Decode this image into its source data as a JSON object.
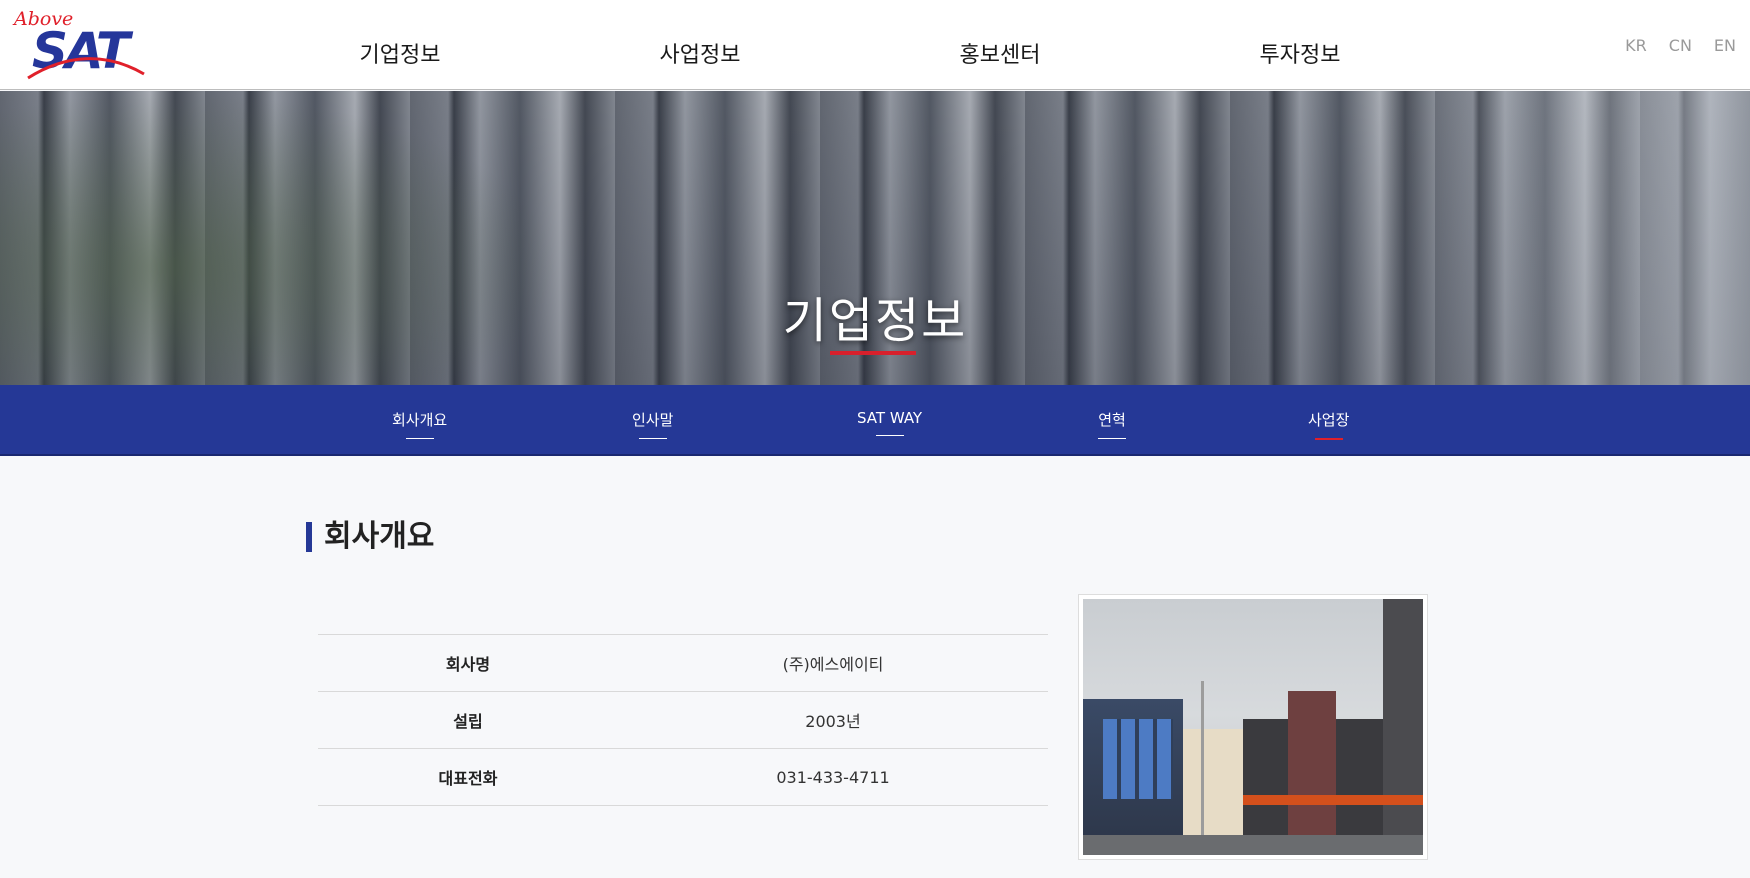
{
  "logo": {
    "above": "Above",
    "sat": "SAT"
  },
  "main_nav": [
    "기업정보",
    "사업정보",
    "홍보센터",
    "투자정보"
  ],
  "lang": [
    "KR",
    "CN",
    "EN"
  ],
  "hero": {
    "title": "기업정보"
  },
  "sub_nav": [
    {
      "label": "회사개요",
      "active": false
    },
    {
      "label": "인사말",
      "active": false
    },
    {
      "label": "SAT WAY",
      "active": false
    },
    {
      "label": "연혁",
      "active": false
    },
    {
      "label": "사업장",
      "active": true
    }
  ],
  "section": {
    "title": "회사개요"
  },
  "info_table": [
    {
      "label": "회사명",
      "value": "(주)에스에이티"
    },
    {
      "label": "설립",
      "value": "2003년"
    },
    {
      "label": "대표전화",
      "value": "031-433-4711"
    }
  ],
  "colors": {
    "brand_blue": "#253896",
    "accent_red": "#e0202a"
  }
}
